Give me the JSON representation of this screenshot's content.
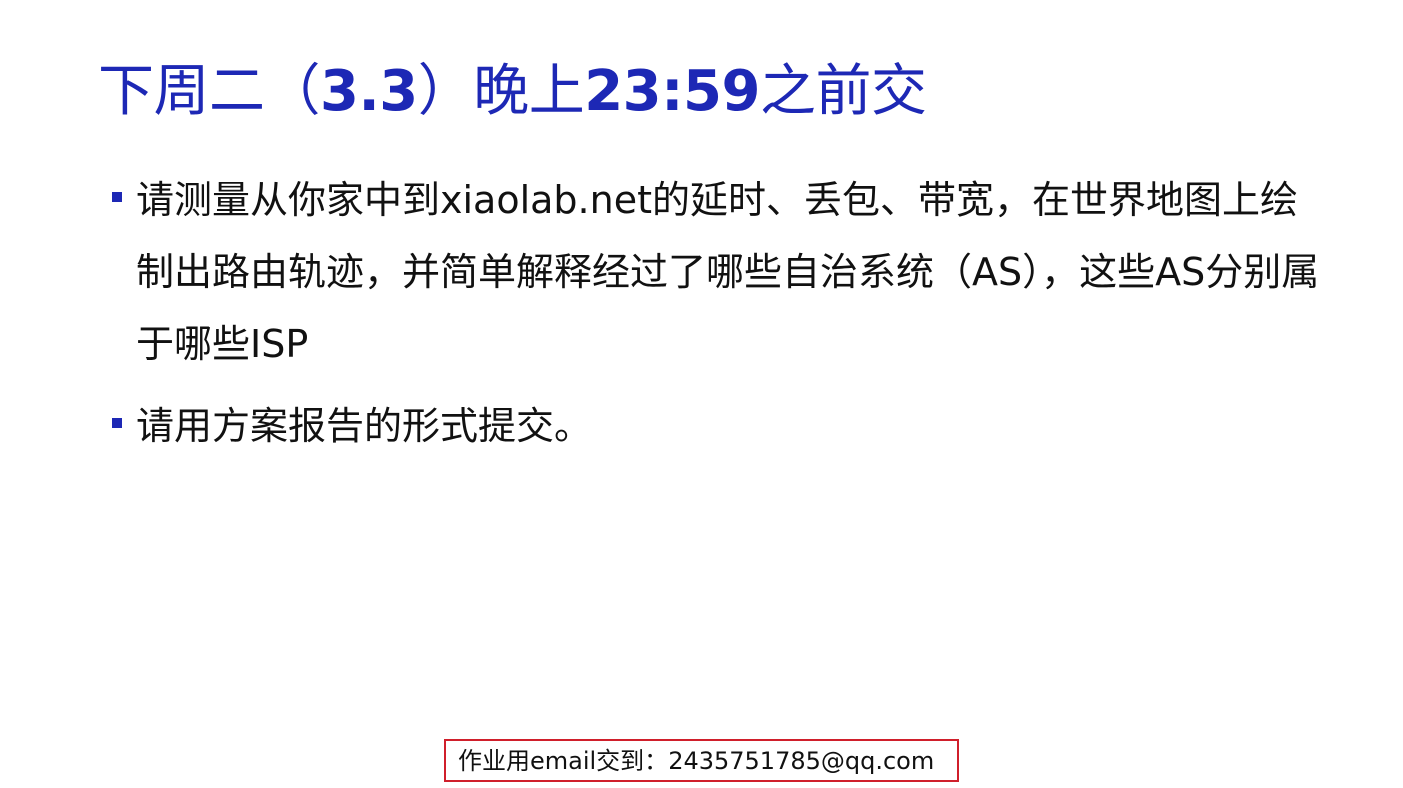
{
  "colors": {
    "title": "#1d28b5",
    "bullet": "#1d28b5",
    "body_text": "#111111",
    "footer_border": "#d01f2b"
  },
  "title": {
    "part1": "下周二（",
    "date": "3.3",
    "part2": "）晚上",
    "time": "23:59",
    "part3": "之前交"
  },
  "bullets": [
    {
      "text": "请测量从你家中到xiaolab.net的延时、丢包、带宽，在世界地图上绘制出路由轨迹，并简单解释经过了哪些自治系统（AS），这些AS分别属于哪些ISP",
      "icon": "square-bullet-icon"
    },
    {
      "text": "请用方案报告的形式提交。",
      "icon": "square-bullet-icon"
    }
  ],
  "footer": {
    "label": "作业用email交到：",
    "email": "2435751785@qq.com"
  }
}
